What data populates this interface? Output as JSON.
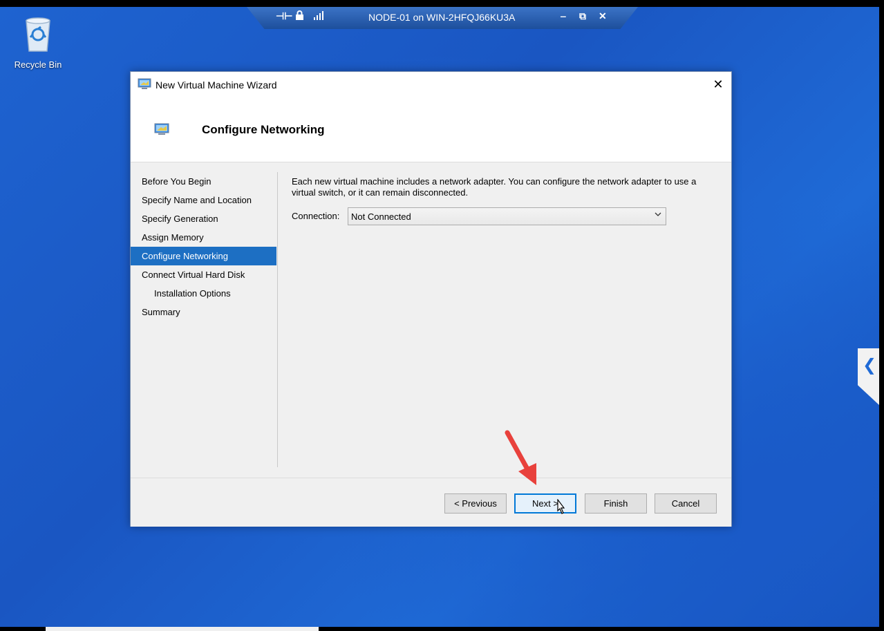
{
  "desktop": {
    "recycle_bin_label": "Recycle Bin"
  },
  "rdp_bar": {
    "title": "NODE-01 on WIN-2HFQJ66KU3A",
    "icons": [
      "pin-icon",
      "lock-icon",
      "signal-icon"
    ],
    "controls": [
      "minimize-icon",
      "restore-icon",
      "close-icon"
    ]
  },
  "wizard": {
    "window_title": "New Virtual Machine Wizard",
    "page_title": "Configure Networking",
    "steps": [
      {
        "label": "Before You Begin"
      },
      {
        "label": "Specify Name and Location"
      },
      {
        "label": "Specify Generation"
      },
      {
        "label": "Assign Memory"
      },
      {
        "label": "Configure Networking",
        "active": true
      },
      {
        "label": "Connect Virtual Hard Disk"
      },
      {
        "label": "Installation Options",
        "sub": true
      },
      {
        "label": "Summary"
      }
    ],
    "description": "Each new virtual machine includes a network adapter. You can configure the network adapter to use a virtual switch, or it can remain disconnected.",
    "connection_label": "Connection:",
    "connection_value": "Not Connected",
    "buttons": {
      "previous": "< Previous",
      "next": "Next >",
      "finish": "Finish",
      "cancel": "Cancel"
    }
  },
  "colors": {
    "selection": "#1d6fc3",
    "desktop": "#1e63d0",
    "annotation_arrow": "#e8413c"
  }
}
